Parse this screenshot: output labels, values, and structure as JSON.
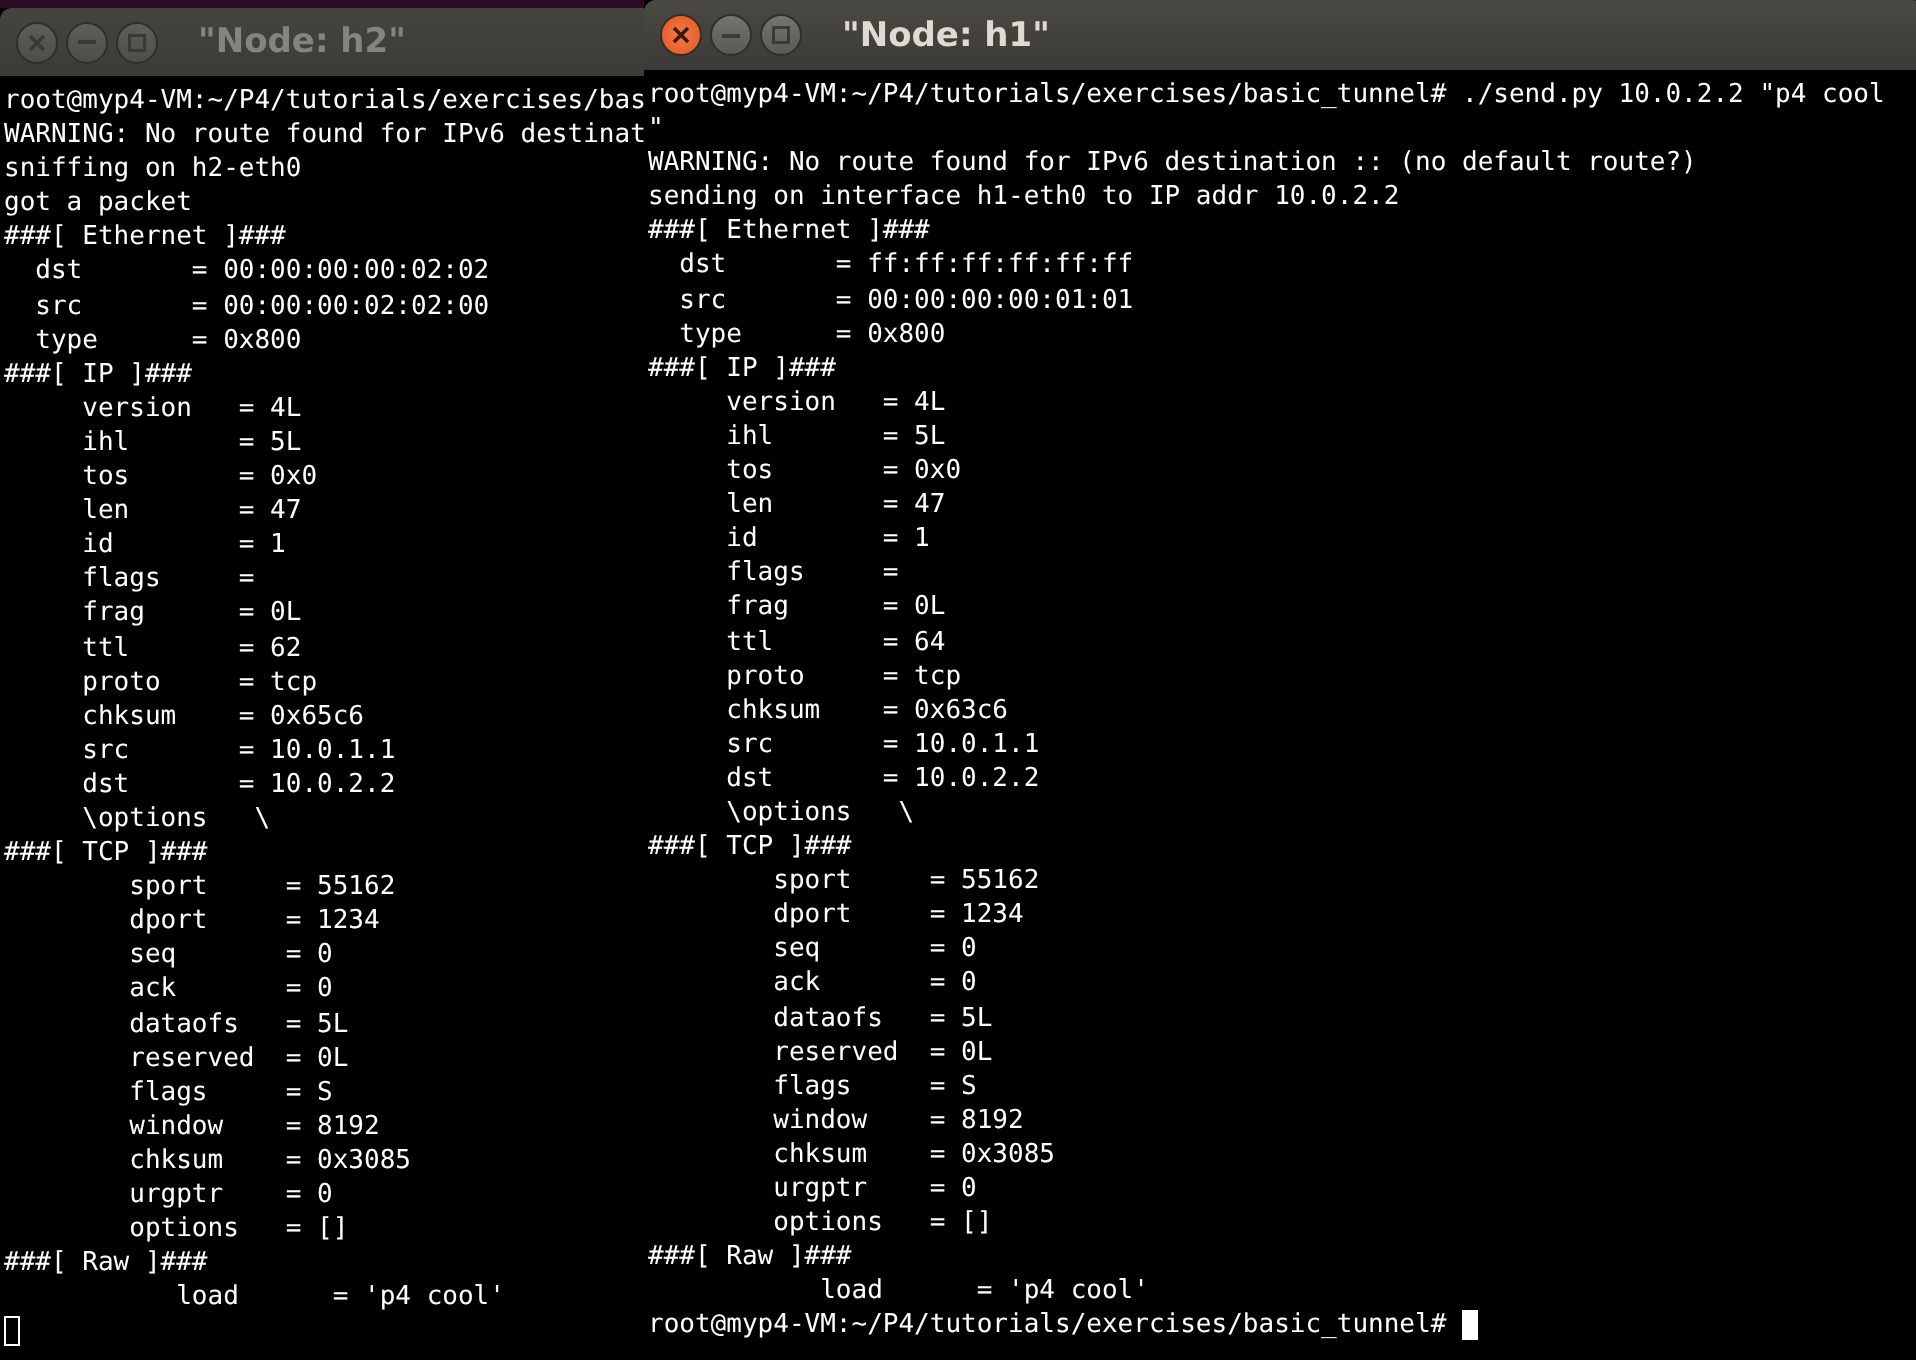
{
  "windows": [
    {
      "title": "\"Node: h2\"",
      "active": false,
      "lines": [
        "root@myp4-VM:~/P4/tutorials/exercises/bas",
        "WARNING: No route found for IPv6 destinat",
        "sniffing on h2-eth0",
        "got a packet",
        "###[ Ethernet ]###",
        "  dst       = 00:00:00:00:02:02",
        "  src       = 00:00:00:02:02:00",
        "  type      = 0x800",
        "###[ IP ]###",
        "     version   = 4L",
        "     ihl       = 5L",
        "     tos       = 0x0",
        "     len       = 47",
        "     id        = 1",
        "     flags     = ",
        "     frag      = 0L",
        "     ttl       = 62",
        "     proto     = tcp",
        "     chksum    = 0x65c6",
        "     src       = 10.0.1.1",
        "     dst       = 10.0.2.2",
        "     \\options   \\",
        "###[ TCP ]###",
        "        sport     = 55162",
        "        dport     = 1234",
        "        seq       = 0",
        "        ack       = 0",
        "        dataofs   = 5L",
        "        reserved  = 0L",
        "        flags     = S",
        "        window    = 8192",
        "        chksum    = 0x3085",
        "        urgptr    = 0",
        "        options   = []",
        "###[ Raw ]###",
        "           load      = 'p4 cool'"
      ]
    },
    {
      "title": "\"Node: h1\"",
      "active": true,
      "prompt": "root@myp4-VM:~/P4/tutorials/exercises/basic_tunnel#",
      "lines": [
        "root@myp4-VM:~/P4/tutorials/exercises/basic_tunnel# ./send.py 10.0.2.2 \"p4 cool",
        "\"",
        "WARNING: No route found for IPv6 destination :: (no default route?)",
        "sending on interface h1-eth0 to IP addr 10.0.2.2",
        "###[ Ethernet ]###",
        "  dst       = ff:ff:ff:ff:ff:ff",
        "  src       = 00:00:00:00:01:01",
        "  type      = 0x800",
        "###[ IP ]###",
        "     version   = 4L",
        "     ihl       = 5L",
        "     tos       = 0x0",
        "     len       = 47",
        "     id        = 1",
        "     flags     = ",
        "     frag      = 0L",
        "     ttl       = 64",
        "     proto     = tcp",
        "     chksum    = 0x63c6",
        "     src       = 10.0.1.1",
        "     dst       = 10.0.2.2",
        "     \\options   \\",
        "###[ TCP ]###",
        "        sport     = 55162",
        "        dport     = 1234",
        "        seq       = 0",
        "        ack       = 0",
        "        dataofs   = 5L",
        "        reserved  = 0L",
        "        flags     = S",
        "        window    = 8192",
        "        chksum    = 0x3085",
        "        urgptr    = 0",
        "        options   = []",
        "###[ Raw ]###",
        "           load      = 'p4 cool'"
      ]
    }
  ]
}
